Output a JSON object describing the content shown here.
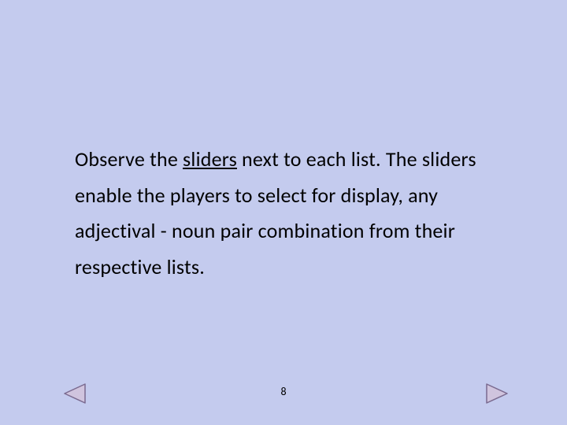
{
  "body": {
    "pre": "Observe the ",
    "underlined": "sliders",
    "post": " next to each list. The sliders enable the players to select for display, any adjectival - noun pair combination from their respective lists."
  },
  "page_number": "8",
  "colors": {
    "background": "#c4cbee",
    "nav_stroke": "#7a6a8f",
    "nav_fill": "#d0c4de"
  }
}
